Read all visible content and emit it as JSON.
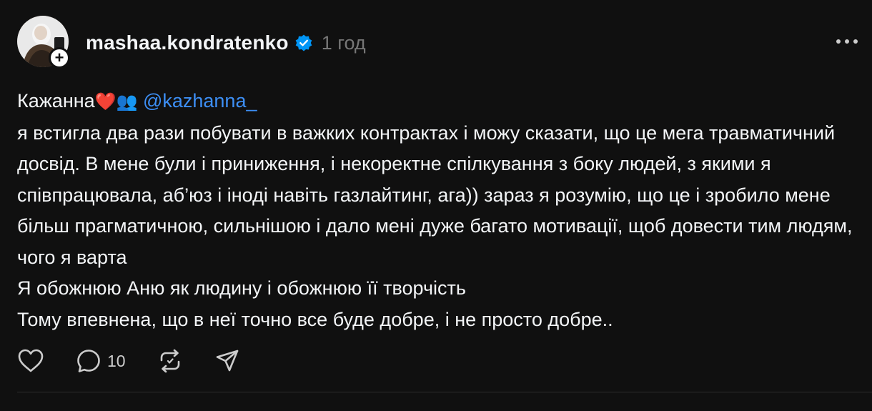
{
  "post": {
    "username": "mashaa.kondratenko",
    "time": "1 год",
    "icons": {
      "verified": "verified-badge-icon",
      "follow": "plus-icon",
      "more": "more-horizontal-icon",
      "like": "heart-icon",
      "comment": "comment-icon",
      "repost": "repost-icon",
      "share": "share-icon"
    },
    "follow_glyph": "+",
    "text": {
      "line1_prefix": "Кажанна",
      "line1_emoji": "❤️👥",
      "mention": "@kazhanna_",
      "p1": "я встигла два рази побувати в важких контрактах і можу сказати, що це мега травматичний досвід. В мене були і приниження, і некоректне спілкування з боку людей, з якими я співпрацювала, аб’юз і іноді навіть газлайтинг, ага)) зараз я розумію, що це і зробило мене більш прагматичною, сильнішою і дало мені дуже багато мотивації, щоб довести тим людям, чого я варта",
      "p2": "Я обожнюю Аню як людину і обожнюю її творчість",
      "p3": "Тому впевнена, що в неї точно все буде добре, і не просто добре.."
    },
    "actions": {
      "comments_count": "10"
    }
  },
  "colors": {
    "background": "#101010",
    "text": "#f3f5f7",
    "muted": "#777777",
    "mention": "#3d8ff5",
    "verified": "#0095f6"
  }
}
